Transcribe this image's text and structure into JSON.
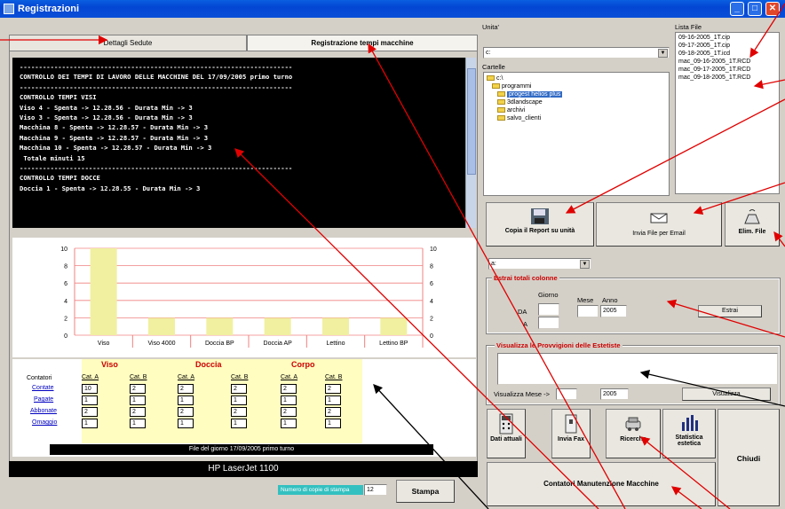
{
  "window": {
    "title": "Registrazioni",
    "minimize": "_",
    "maximize": "□",
    "close": "✕"
  },
  "tabs": [
    {
      "label": "Dettagli Sedute"
    },
    {
      "label": "Registrazione tempi macchine"
    }
  ],
  "console_lines": [
    "-----------------------------------------------------------------------",
    "CONTROLLO DEI TEMPI DI LAVORO DELLE MACCHINE DEL 17/09/2005 primo turno",
    "-----------------------------------------------------------------------",
    "CONTROLLO TEMPI VISI",
    "Viso 4 - Spenta -> 12.28.56 - Durata Min -> 3",
    "Viso 3 - Spenta -> 12.28.56 - Durata Min -> 3",
    "Macchina 8 - Spenta -> 12.28.57 - Durata Min -> 3",
    "Macchina 9 - Spenta -> 12.28.57 - Durata Min -> 3",
    "Macchina 10 - Spenta -> 12.28.57 - Durata Min -> 3",
    " Totale minuti 15",
    "-----------------------------------------------------------------------",
    "CONTROLLO TEMPI DOCCE",
    "Doccia 1 - Spenta -> 12.28.55 - Durata Min -> 3"
  ],
  "chart_data": {
    "type": "bar",
    "categories": [
      "Viso",
      "Viso 4000",
      "Doccia BP",
      "Doccia AP",
      "Lettino",
      "Lettino BP"
    ],
    "values": [
      10,
      2,
      2,
      2,
      2,
      2
    ],
    "ylim": [
      0,
      10
    ],
    "yticks": [
      "0",
      "2",
      "4",
      "6",
      "8",
      "10"
    ],
    "bar_color": "#f0f0a0",
    "grid_color": "#f08080"
  },
  "counters": {
    "groups": [
      "Viso",
      "Doccia",
      "Corpo"
    ],
    "columns": [
      "Cat. A",
      "Cat. B",
      "Cat. A",
      "Cat. B",
      "Cat. A",
      "Cat. B"
    ],
    "header_label": "Contatori",
    "rows": [
      {
        "label": "Contate",
        "values": [
          "10",
          "2",
          "2",
          "2",
          "2",
          "2"
        ]
      },
      {
        "label": "Pagate",
        "values": [
          "1",
          "1",
          "1",
          "1",
          "1",
          "1"
        ]
      },
      {
        "label": "Abbonate",
        "values": [
          "2",
          "2",
          "2",
          "2",
          "2",
          "2"
        ]
      },
      {
        "label": "Omaggio",
        "values": [
          "1",
          "1",
          "1",
          "1",
          "1",
          "1"
        ]
      }
    ],
    "footer": "File del giorno 17/09/2005 primo turno"
  },
  "printer": "HP LaserJet 1100",
  "print_controls": {
    "copies_label": "Numero di copie di stampa",
    "copies_value": "12",
    "print_button": "Stampa"
  },
  "right": {
    "drive_label": "Unita'",
    "drive_value": "c:",
    "folder_label": "Cartelle",
    "folders": [
      "c:\\",
      "programmi",
      "progest helios plus",
      "3dlandscape",
      "archivi",
      "salvo_clienti"
    ],
    "files_label": "Lista File",
    "files": [
      "09-16-2005_1T.cip",
      "09-17-2005_1T.cip",
      "09-18-2005_1T.icd",
      "mac_09-16-2005_1T.RCD",
      "mac_09-17-2005_1T.RCD",
      "mac_09-18-2005_1T.RCD"
    ],
    "copy_button": "Copia il Report su unità",
    "email_button": "Invia File per Email",
    "delete_button": "Elim. File",
    "unit_combo": "a:",
    "extract_group": "Estrai totali colonne",
    "giorno": "Giorno",
    "mese": "Mese",
    "anno": "Anno",
    "da": "DA",
    "a": "A",
    "anno_value": "2005",
    "extract_button": "Estrai",
    "provvigioni_group": "Visualizza le Provvigioni delle Estetiste",
    "vis_mese_label": "Visualizza Mese ->",
    "vis_anno": "2005",
    "visualizza_button": "Visualizza",
    "dati_button": "Dati attuali",
    "fax_button": "Invia Fax",
    "ricerche_button": "Ricerche",
    "statistica_button": "Statistica estetica",
    "chiudi_button": "Chiudi",
    "contatori_button": "Contatori Manutenzione Macchine"
  }
}
